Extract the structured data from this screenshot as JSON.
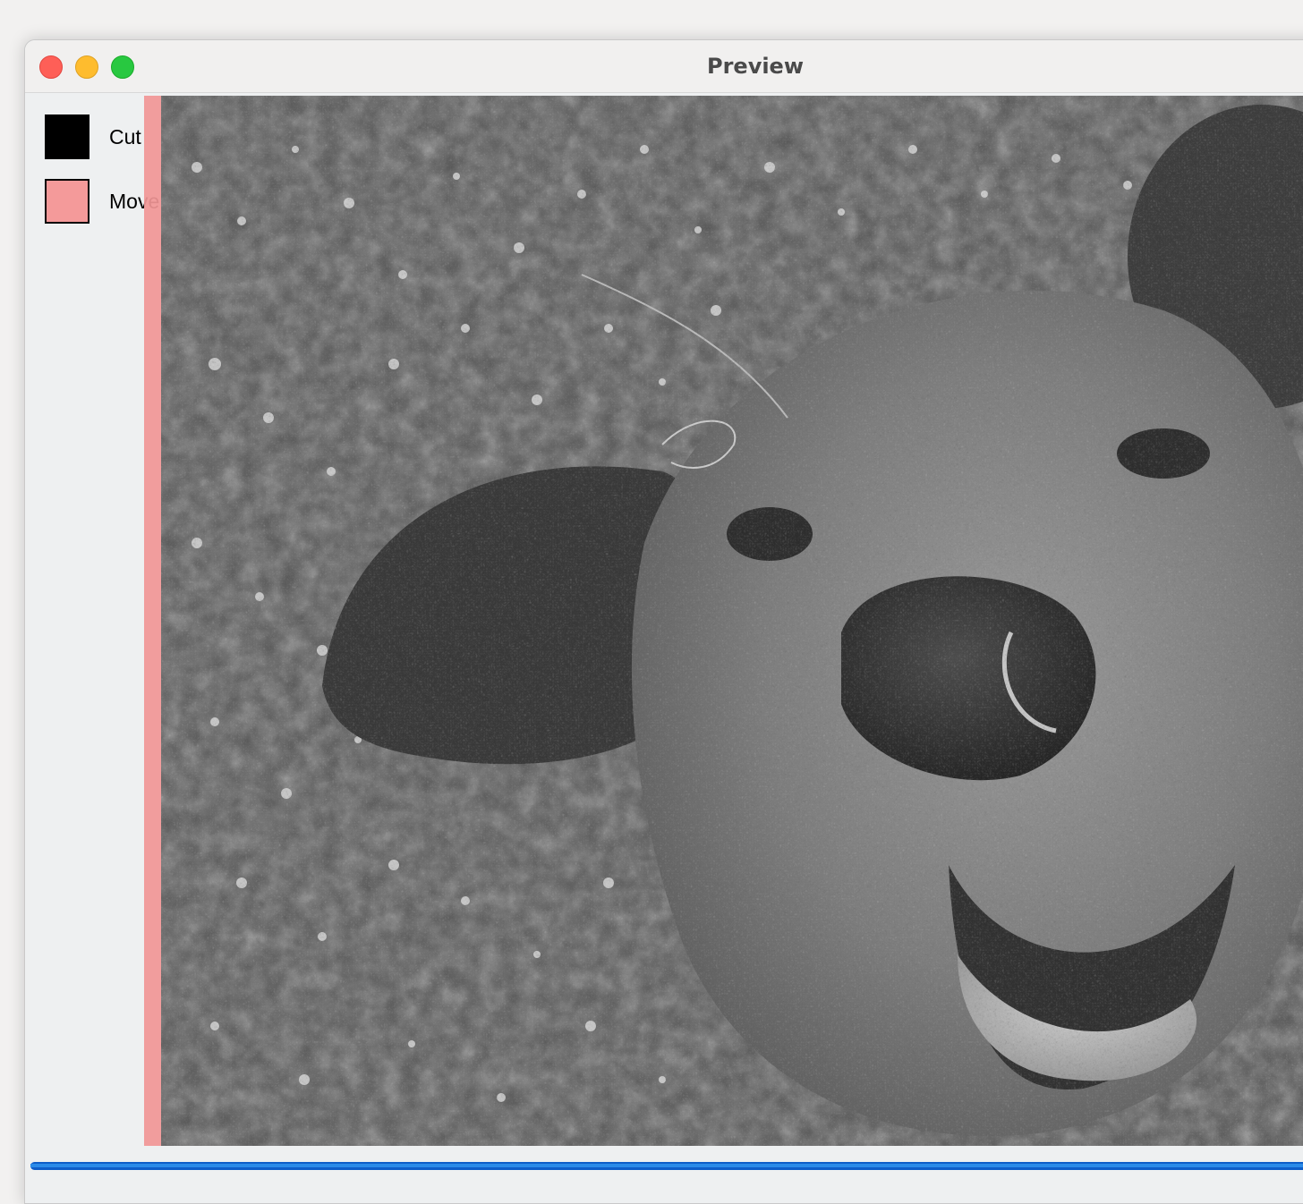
{
  "window": {
    "title": "Preview"
  },
  "legend": [
    {
      "label": "Cut",
      "color": "#000000"
    },
    {
      "label": "Move",
      "color": "#f49a9a"
    }
  ],
  "image": {
    "icon": "photo-dog-grayscale"
  },
  "progress": {
    "value": 1.0
  }
}
